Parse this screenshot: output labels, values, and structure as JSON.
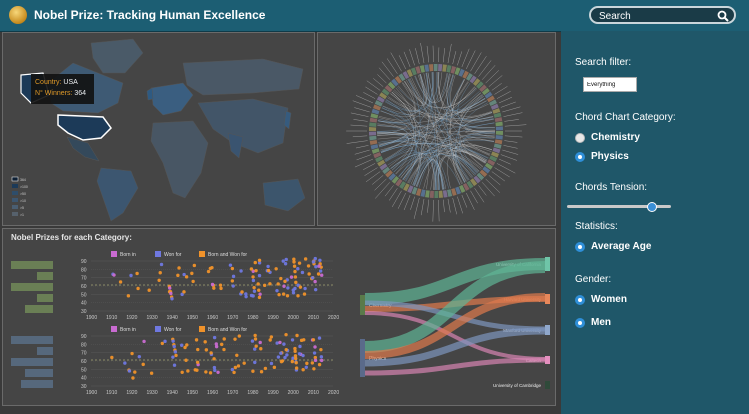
{
  "header": {
    "title": "Nobel Prize: Tracking Human Excellence"
  },
  "search": {
    "placeholder": "Search",
    "value": "",
    "icon": "search-icon"
  },
  "map": {
    "tooltip": {
      "country_key": "Country:",
      "country_value": "USA",
      "winners_key": "N° Winners:",
      "winners_value": "364"
    }
  },
  "bottom": {
    "title": "Nobel Prizes for each Category:",
    "legend": [
      "Born in",
      "Won for",
      "Born and Won for"
    ],
    "legend_colors": [
      "#c96bd1",
      "#6f78e0",
      "#f0922a"
    ],
    "x_ticks": [
      "1900",
      "1910",
      "1920",
      "1930",
      "1940",
      "1950",
      "1960",
      "1970",
      "1980",
      "1990",
      "2000",
      "2010",
      "2020"
    ],
    "y_ticks": [
      "90",
      "80",
      "70",
      "60",
      "50",
      "40",
      "30"
    ]
  },
  "sankey": {
    "left_nodes": [
      "Chemistry",
      "Physics"
    ],
    "right_nodes": [
      "University of California",
      "Harvard University",
      "Stanford University",
      "Caltech",
      "University of Cambridge"
    ]
  },
  "sidebar": {
    "search_filter_label": "Search filter:",
    "search_filter_value": "Everything",
    "chord_category_label": "Chord Chart Category:",
    "chord_options": [
      {
        "label": "Chemistry",
        "selected": false
      },
      {
        "label": "Physics",
        "selected": true
      }
    ],
    "tension_label": "Chords Tension:",
    "tension_value": 0.8,
    "statistics_label": "Statistics:",
    "statistics_option": "Average Age",
    "gender_label": "Gender:",
    "gender_options": [
      "Women",
      "Men"
    ]
  },
  "colors": {
    "header": "#1c5e73",
    "sidebar": "#1f5769",
    "map_country": "#32536e",
    "highlight": "#1c3a58",
    "accent": "#2f8fd8"
  }
}
